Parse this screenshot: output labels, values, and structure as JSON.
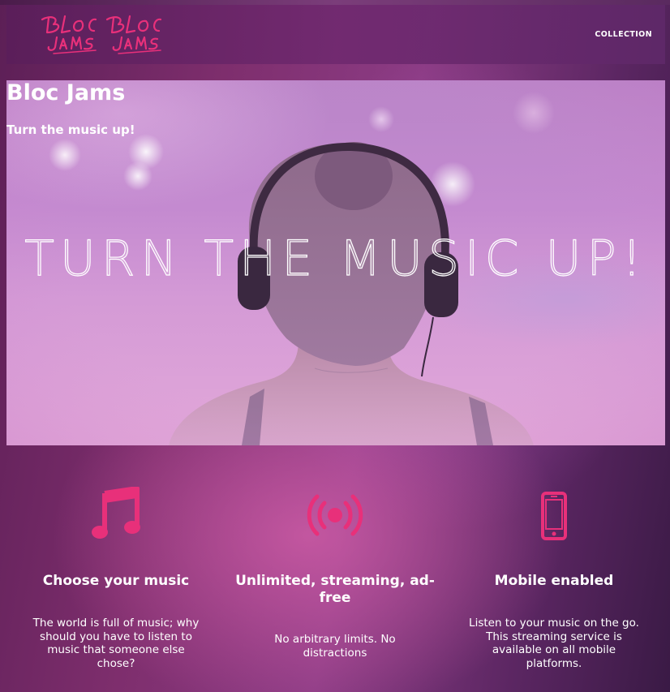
{
  "navbar": {
    "logo_text": "Bloc Jams",
    "links": [
      {
        "label": "COLLECTION"
      }
    ]
  },
  "hero": {
    "title": "Bloc Jams",
    "subtitle": "Turn the music up!",
    "headline": "TURN THE MUSIC UP!"
  },
  "features": [
    {
      "icon": "music-note-icon",
      "title": "Choose your music",
      "description": "The world is full of music; why should you have to listen to music that someone else chose?"
    },
    {
      "icon": "radio-signal-icon",
      "title": "Unlimited, streaming, ad-free",
      "description": "No arbitrary limits. No distractions"
    },
    {
      "icon": "mobile-phone-icon",
      "title": "Mobile enabled",
      "description": "Listen to your music on the go. This streaming service is available on all mobile platforms."
    }
  ],
  "colors": {
    "accent": "#e8307a",
    "nav_background": "#6e2a6e",
    "hero_tint": "#c48ad0"
  }
}
